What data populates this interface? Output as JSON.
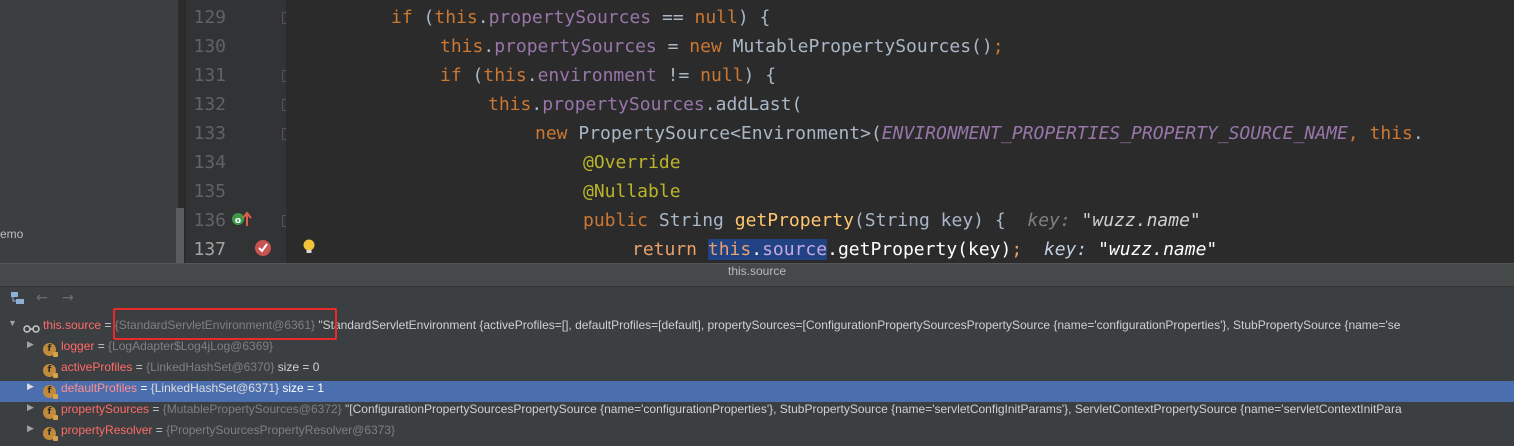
{
  "left_panel": {
    "fragment": "emo"
  },
  "gutter": {
    "line_numbers": [
      "129",
      "130",
      "131",
      "132",
      "133",
      "134",
      "135",
      "136",
      "137"
    ]
  },
  "code": {
    "l129": {
      "kw_if": "if",
      "p1": " (",
      "kw_this": "this",
      "dot": ".",
      "field": "propertySources",
      "rest": " == ",
      "kw_null": "null",
      "end": ") {"
    },
    "l130": {
      "kw_this": "this",
      "dot": ".",
      "field": "propertySources",
      "eq": " = ",
      "kw_new": "new",
      "cls": " MutablePropertySources()",
      "semi": ";"
    },
    "l131": {
      "kw_if": "if",
      "p1": " (",
      "kw_this": "this",
      "dot": ".",
      "field": "environment",
      "rest": " != ",
      "kw_null": "null",
      "end": ") {"
    },
    "l132": {
      "kw_this": "this",
      "dot": ".",
      "field": "propertySources",
      "call": ".addLast("
    },
    "l133": {
      "kw_new": "new",
      "cls": " PropertySource<Environment>(",
      "const": "ENVIRONMENT_PROPERTIES_PROPERTY_SOURCE_NAME",
      "comma": ", ",
      "kw_this": "this",
      "tail": "."
    },
    "l134": {
      "annotation": "@Override"
    },
    "l135": {
      "annotation": "@Nullable"
    },
    "l136": {
      "kw_public": "public",
      "sig1": " String ",
      "fn": "getProperty",
      "sig2": "(String key) {",
      "hint_label": "key: ",
      "hint_value": "\"wuzz.name\""
    },
    "l137": {
      "kw_return": "return",
      "sp": " ",
      "kw_this": "this",
      "dot": ".",
      "field": "source",
      "call": ".getProperty(key)",
      "semi": ";",
      "hint_label": "key: ",
      "hint_value": "\"wuzz.name\""
    }
  },
  "popup": {
    "title": "this.source",
    "tools": {
      "tree_icon": "tree-view-icon",
      "back": "←",
      "forward": "→"
    },
    "root": {
      "name": "this.source",
      "eq": " = ",
      "type": "{StandardServletEnvironment@6361}",
      "value": " \"StandardServletEnvironment {activeProfiles=[], defaultProfiles=[default], propertySources=[ConfigurationPropertySourcesPropertySource {name='configurationProperties'}, StubPropertySource {name='se"
    },
    "children": [
      {
        "name": "logger",
        "eq": " = ",
        "type": "{LogAdapter$Log4jLog@6369}",
        "value": "",
        "expandable": true
      },
      {
        "name": "activeProfiles",
        "eq": " = ",
        "type": "{LinkedHashSet@6370}",
        "value": "  size = 0",
        "expandable": false
      },
      {
        "name": "defaultProfiles",
        "eq": " = ",
        "type": "{LinkedHashSet@6371}",
        "value": "  size = 1",
        "expandable": true
      },
      {
        "name": "propertySources",
        "eq": " = ",
        "type": "{MutablePropertySources@6372}",
        "value": " \"[ConfigurationPropertySourcesPropertySource {name='configurationProperties'}, StubPropertySource {name='servletConfigInitParams'}, ServletContextPropertySource {name='servletContextInitPara",
        "expandable": true
      },
      {
        "name": "propertyResolver",
        "eq": " = ",
        "type": "{PropertySourcesPropertyResolver@6373}",
        "value": "",
        "expandable": true
      }
    ]
  },
  "colors": {
    "editor_bg": "#2b2b2b",
    "keyword": "#cc7832",
    "field": "#9876aa",
    "function": "#ffc66d",
    "annotation": "#bbb529",
    "execution_line": "#2d6099",
    "selected_row": "#4b6eaf",
    "highlight_box": "#e82a2a"
  }
}
